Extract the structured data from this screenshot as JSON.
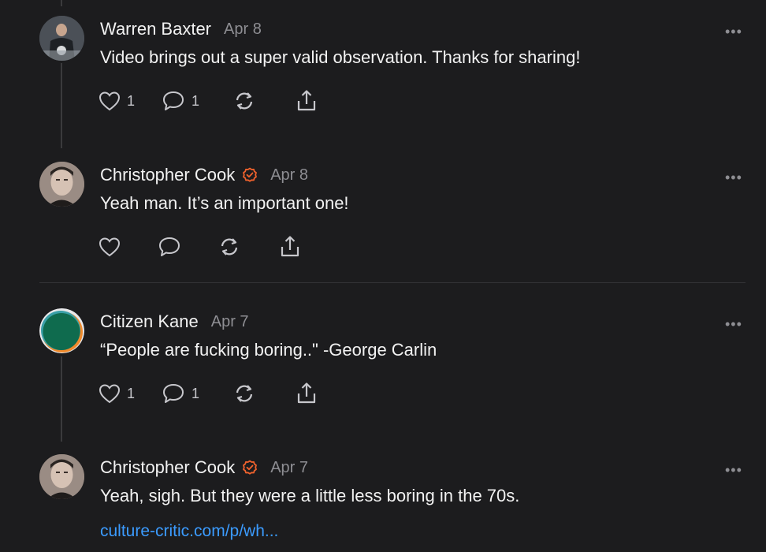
{
  "accent_link": "#3b9bff",
  "verified_color": "#f0622d",
  "comments": [
    {
      "author": "Warren Baxter",
      "date": "Apr 8",
      "text": "Video brings out a super valid observation. Thanks for sharing!",
      "likes": "1",
      "replies": "1",
      "verified": false
    },
    {
      "author": "Christopher Cook",
      "date": "Apr 8",
      "text": "Yeah man. It’s an important one!",
      "verified": true
    },
    {
      "author": "Citizen Kane",
      "date": "Apr 7",
      "text": "“People are fucking boring..\" -George Carlin",
      "likes": "1",
      "replies": "1",
      "verified": false
    },
    {
      "author": "Christopher Cook",
      "date": "Apr 7",
      "text": "Yeah, sigh. But they were a little less boring in the 70s.",
      "link": "culture-critic.com/p/wh...",
      "verified": true
    }
  ],
  "more_label": "•••",
  "icons": [
    "heart-icon",
    "comment-icon",
    "restack-icon",
    "share-icon",
    "verified-badge-icon",
    "more-icon"
  ]
}
